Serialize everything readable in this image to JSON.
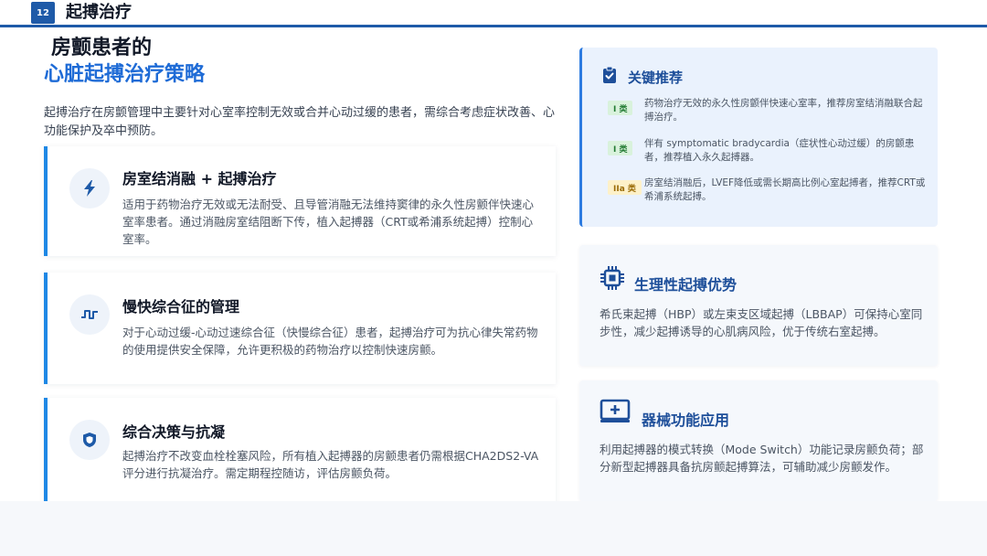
{
  "header": {
    "page_number": "12",
    "section_title": "起搏治疗"
  },
  "title": {
    "line1": "房颤患者的",
    "line2": "心脏起搏治疗策略"
  },
  "intro": "起搏治疗在房颤管理中主要针对心室率控制无效或合并心动过缓的患者，需综合考虑症状改善、心功能保护及卒中预防。",
  "strategies": [
    {
      "icon": "lightning-icon",
      "title": "房室结消融 + 起搏治疗",
      "body": "适用于药物治疗无效或无法耐受、且导管消融无法维持窦律的永久性房颤伴快速心室率患者。通过消融房室结阻断下传，植入起搏器（CRT或希浦系统起搏）控制心室率。"
    },
    {
      "icon": "pulse-wave-icon",
      "title": "慢快综合征的管理",
      "body": "对于心动过缓-心动过速综合征（快慢综合征）患者，起搏治疗可为抗心律失常药物的使用提供安全保障，允许更积极的药物治疗以控制快速房颤。"
    },
    {
      "icon": "shield-icon",
      "title": "综合决策与抗凝",
      "body": "起搏治疗不改变血栓栓塞风险，所有植入起搏器的房颤患者仍需根据CHA2DS2-VA 评分进行抗凝治疗。需定期程控随访，评估房颤负荷。"
    }
  ],
  "recommendations": {
    "icon": "clipboard-check-icon",
    "title": "关键推荐",
    "items": [
      {
        "badge": "I 类",
        "text": "药物治疗无效的永久性房颤伴快速心室率，推荐房室结消融联合起搏治疗。"
      },
      {
        "badge": "I 类",
        "text": "伴有 symptomatic bradycardia（症状性心动过缓）的房颤患者，推荐植入永久起搏器。"
      },
      {
        "badge": "IIa 类",
        "text": "房室结消融后，LVEF降低或需长期高比例心室起搏者，推荐CRT或希浦系统起搏。"
      }
    ]
  },
  "physiologic": {
    "icon": "chip-icon",
    "title": "生理性起搏优势",
    "body": "希氏束起搏（HBP）或左束支区域起搏（LBBAP）可保持心室同步性，减少起搏诱导的心肌病风险，优于传统右室起搏。"
  },
  "device": {
    "icon": "monitor-plus-icon",
    "title": "器械功能应用",
    "body": "利用起搏器的模式转换（Mode Switch）功能记录房颤负荷；部分新型起搏器具备抗房颤起搏算法，可辅助减少房颤发作。"
  },
  "colors": {
    "brand_blue": "#1e5aa8",
    "accent_blue": "#1e88e5",
    "title_blue": "#1e6bd6",
    "class_i_green": "#227a33",
    "class_iia_amber": "#9a6b06"
  }
}
